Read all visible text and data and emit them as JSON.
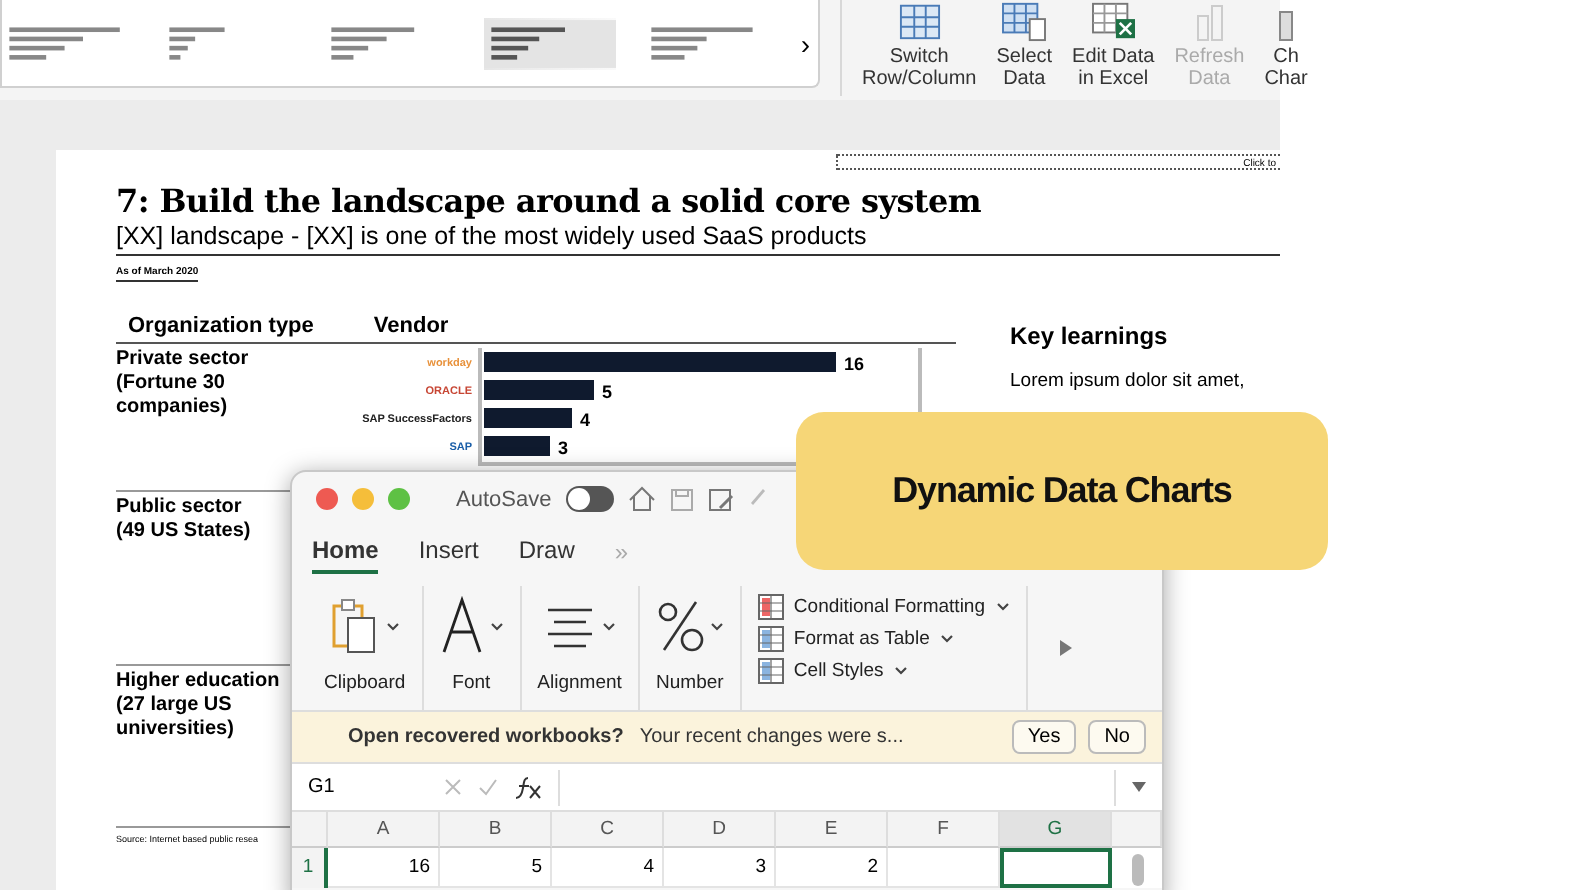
{
  "chart_ribbon": {
    "gallery": [
      {
        "selected": false
      },
      {
        "selected": false
      },
      {
        "selected": false
      },
      {
        "selected": true
      },
      {
        "selected": false
      }
    ],
    "more_label": "›",
    "buttons": [
      {
        "label": "Switch\nRow/Column",
        "kind": "switch",
        "disabled": false
      },
      {
        "label": "Select\nData",
        "kind": "select",
        "disabled": false
      },
      {
        "label": "Edit Data\nin Excel",
        "kind": "excel",
        "disabled": false
      },
      {
        "label": "Refresh\nData",
        "kind": "refresh",
        "disabled": true
      },
      {
        "label": "Ch\nChar",
        "kind": "chart",
        "disabled": false
      }
    ]
  },
  "slide": {
    "placeholder_hint": "Click to",
    "title": "7: Build the landscape around a solid core system",
    "subtitle": "[XX] landscape -  [XX] is one of the most widely used SaaS products",
    "as_of": "As of March 2020",
    "columns": [
      "Organization type",
      "Vendor"
    ],
    "sections": [
      {
        "label": "Private sector\n(Fortune 30\ncompanies)"
      },
      {
        "label": "Public sector\n(49 US States)"
      },
      {
        "label": "Higher education\n(27 large US\nuniversities)"
      }
    ],
    "chart_data": {
      "type": "bar",
      "orientation": "horizontal",
      "categories": [
        "workday",
        "ORACLE",
        "SAP SuccessFactors",
        "SAP"
      ],
      "values": [
        16,
        5,
        4,
        3
      ],
      "data_labels": true
    },
    "key_learnings": {
      "title": "Key learnings",
      "text": "Lorem ipsum dolor sit amet,"
    },
    "source": "Source: Internet based public resea"
  },
  "excel": {
    "autosave": {
      "label": "AutoSave",
      "on": false
    },
    "tabs": [
      {
        "label": "Home",
        "selected": true
      },
      {
        "label": "Insert",
        "selected": false
      },
      {
        "label": "Draw",
        "selected": false
      }
    ],
    "tabs_more": "»",
    "groups": [
      {
        "label": "Clipboard",
        "kind": "clipboard"
      },
      {
        "label": "Font",
        "kind": "font"
      },
      {
        "label": "Alignment",
        "kind": "alignment"
      },
      {
        "label": "Number",
        "kind": "number"
      }
    ],
    "styles": [
      {
        "label": "Conditional Formatting",
        "kind": "conditional"
      },
      {
        "label": "Format as Table",
        "kind": "table"
      },
      {
        "label": "Cell Styles",
        "kind": "cellstyles"
      }
    ],
    "message": {
      "title": "Open recovered workbooks?",
      "text": "Your recent changes were s...",
      "buttons": [
        "Yes",
        "No"
      ]
    },
    "name_box": "G1",
    "columns": [
      {
        "label": "A",
        "selected": false
      },
      {
        "label": "B",
        "selected": false
      },
      {
        "label": "C",
        "selected": false
      },
      {
        "label": "D",
        "selected": false
      },
      {
        "label": "E",
        "selected": false
      },
      {
        "label": "F",
        "selected": false
      },
      {
        "label": "G",
        "selected": true
      }
    ],
    "rows": [
      {
        "header": "1",
        "cells": [
          "16",
          "5",
          "4",
          "3",
          "2"
        ]
      }
    ]
  },
  "callout": {
    "text": "Dynamic Data Charts"
  }
}
